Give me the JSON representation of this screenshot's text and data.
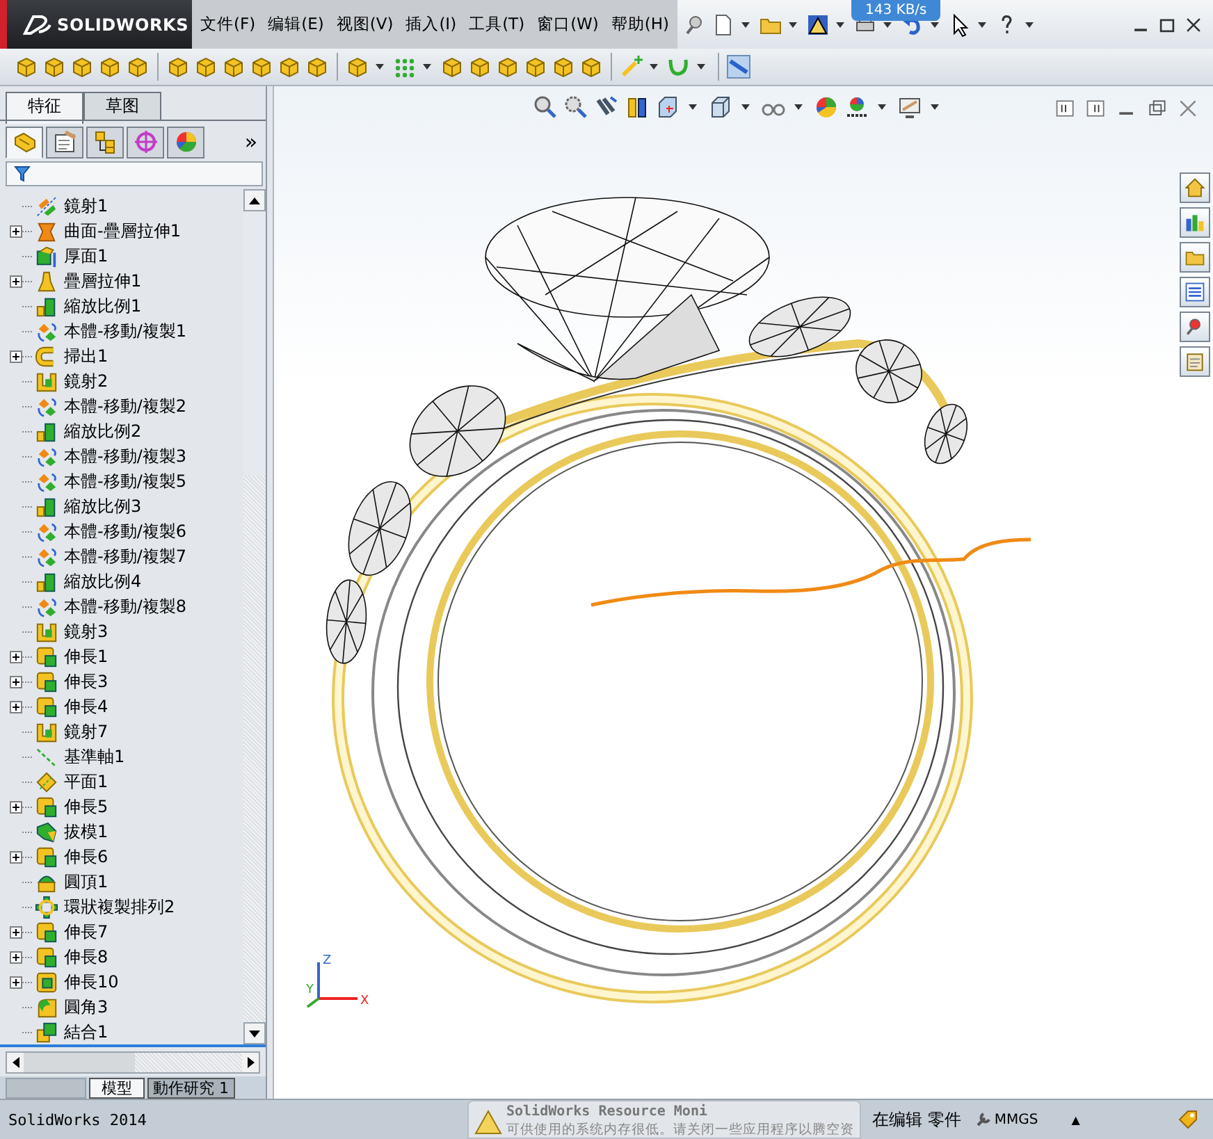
{
  "window": {
    "logo": "SOLIDWORKS"
  },
  "menu": [
    {
      "label": "文件(F)"
    },
    {
      "label": "编辑(E)"
    },
    {
      "label": "视图(V)"
    },
    {
      "label": "插入(I)"
    },
    {
      "label": "工具(T)"
    },
    {
      "label": "窗口(W)"
    },
    {
      "label": "帮助(H)"
    }
  ],
  "network_badge": "143 KB/s",
  "sidebar": {
    "tabs": [
      {
        "label": "特征",
        "selected": true
      },
      {
        "label": "草图",
        "selected": false
      }
    ],
    "panel_tabs": [
      {
        "kind": "feature-tree",
        "selected": true
      },
      {
        "kind": "property",
        "selected": false
      },
      {
        "kind": "configuration",
        "selected": false
      },
      {
        "kind": "dimxpert",
        "selected": false
      },
      {
        "kind": "display",
        "selected": false
      }
    ],
    "overflow": "»",
    "tree": [
      {
        "label": "鏡射1",
        "kind": "mirror-body",
        "expandable": false
      },
      {
        "label": "曲面-疊層拉伸1",
        "kind": "surface-loft",
        "expandable": true
      },
      {
        "label": "厚面1",
        "kind": "thicken",
        "expandable": false
      },
      {
        "label": "疊層拉伸1",
        "kind": "loft",
        "expandable": true
      },
      {
        "label": "縮放比例1",
        "kind": "scale",
        "expandable": false
      },
      {
        "label": "本體-移動/複製1",
        "kind": "move",
        "expandable": false
      },
      {
        "label": "掃出1",
        "kind": "sweep",
        "expandable": true
      },
      {
        "label": "鏡射2",
        "kind": "mirror",
        "expandable": false
      },
      {
        "label": "本體-移動/複製2",
        "kind": "move",
        "expandable": false
      },
      {
        "label": "縮放比例2",
        "kind": "scale",
        "expandable": false
      },
      {
        "label": "本體-移動/複製3",
        "kind": "move",
        "expandable": false
      },
      {
        "label": "本體-移動/複製5",
        "kind": "move",
        "expandable": false
      },
      {
        "label": "縮放比例3",
        "kind": "scale",
        "expandable": false
      },
      {
        "label": "本體-移動/複製6",
        "kind": "move",
        "expandable": false
      },
      {
        "label": "本體-移動/複製7",
        "kind": "move",
        "expandable": false
      },
      {
        "label": "縮放比例4",
        "kind": "scale",
        "expandable": false
      },
      {
        "label": "本體-移動/複製8",
        "kind": "move",
        "expandable": false
      },
      {
        "label": "鏡射3",
        "kind": "mirror",
        "expandable": false
      },
      {
        "label": "伸長1",
        "kind": "extrude",
        "expandable": true
      },
      {
        "label": "伸長3",
        "kind": "extrude",
        "expandable": true
      },
      {
        "label": "伸長4",
        "kind": "extrude",
        "expandable": true
      },
      {
        "label": "鏡射7",
        "kind": "mirror",
        "expandable": false
      },
      {
        "label": "基準軸1",
        "kind": "axis",
        "expandable": false
      },
      {
        "label": "平面1",
        "kind": "plane",
        "expandable": false
      },
      {
        "label": "伸長5",
        "kind": "extrude",
        "expandable": true
      },
      {
        "label": "拔模1",
        "kind": "draft",
        "expandable": false
      },
      {
        "label": "伸長6",
        "kind": "extrude",
        "expandable": true
      },
      {
        "label": "圓頂1",
        "kind": "dome",
        "expandable": false
      },
      {
        "label": "環狀複製排列2",
        "kind": "pattern",
        "expandable": false
      },
      {
        "label": "伸長7",
        "kind": "extrude",
        "expandable": true
      },
      {
        "label": "伸長8",
        "kind": "extrude",
        "expandable": true
      },
      {
        "label": "伸長10",
        "kind": "boss",
        "expandable": true
      },
      {
        "label": "圓角3",
        "kind": "fillet",
        "expandable": false
      },
      {
        "label": "結合1",
        "kind": "combine",
        "expandable": false
      }
    ],
    "bottom_tabs": [
      {
        "label": "模型",
        "selected": true
      },
      {
        "label": "動作研究 1",
        "selected": false
      }
    ]
  },
  "triad": {
    "x": "X",
    "y": "Y",
    "z": "Z"
  },
  "notification": {
    "title": "SolidWorks Resource Moni",
    "message": "可供使用的系统内存很低。请关闭一些应用程序以腾空资"
  },
  "status_bar": {
    "app": "SolidWorks 2014",
    "mode": "在编辑 零件",
    "units": "MMGS",
    "arrow": "▲"
  }
}
